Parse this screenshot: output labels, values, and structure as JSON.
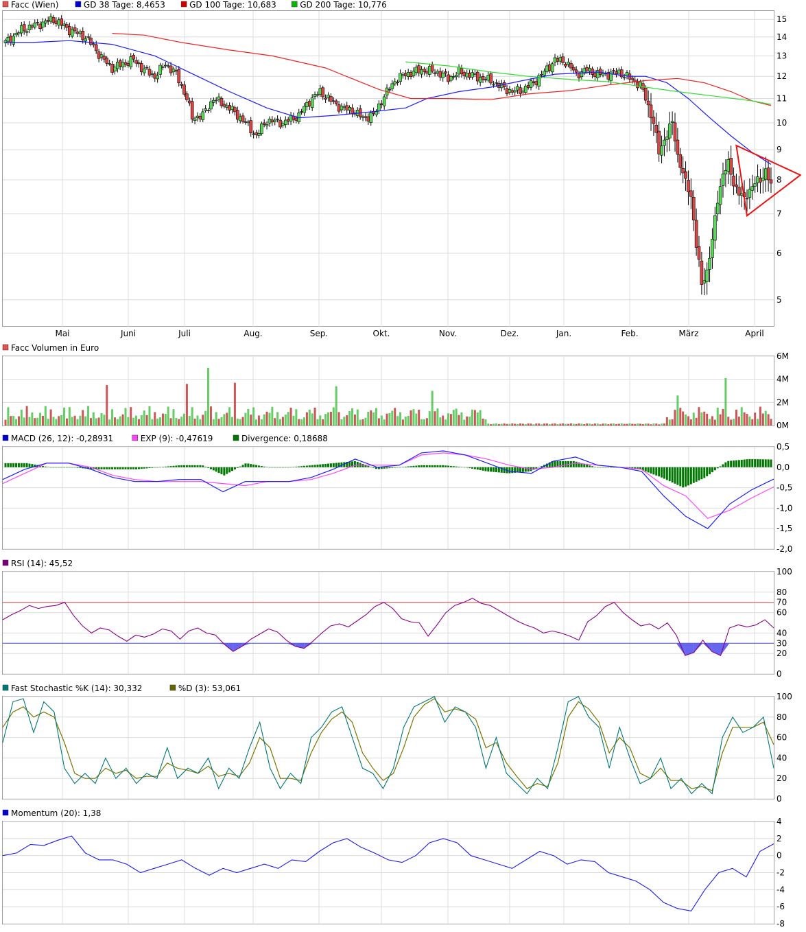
{
  "chart_data": [
    {
      "type": "candlestick",
      "panel": "price",
      "legend": [
        {
          "label": "Facc (Wien)",
          "color": "#e05050"
        },
        {
          "label": "GD 38 Tage: 8,4653",
          "color": "#0000cc"
        },
        {
          "label": "GD 100 Tage: 10,683",
          "color": "#cc0000"
        },
        {
          "label": "GD 200 Tage: 10,776",
          "color": "#00bb00"
        }
      ],
      "x_months": [
        "Mai",
        "Juni",
        "Juli",
        "Aug.",
        "Sep.",
        "Okt.",
        "Nov.",
        "Dez.",
        "Jan.",
        "Feb.",
        "März",
        "April"
      ],
      "y_ticks": [
        "15",
        "14",
        "13",
        "12",
        "11",
        "10",
        "9",
        "8",
        "7",
        "6",
        "5"
      ],
      "ylim": [
        4.5,
        15.5
      ],
      "y_scale": "log",
      "close_anchors": [
        [
          0,
          13.7
        ],
        [
          6,
          14.4
        ],
        [
          12,
          14.7
        ],
        [
          18,
          15.0
        ],
        [
          24,
          14.4
        ],
        [
          30,
          14.0
        ],
        [
          34,
          13.3
        ],
        [
          36,
          12.9
        ],
        [
          40,
          12.4
        ],
        [
          44,
          12.6
        ],
        [
          48,
          12.8
        ],
        [
          52,
          12.3
        ],
        [
          56,
          12.0
        ],
        [
          60,
          12.6
        ],
        [
          64,
          12.1
        ],
        [
          68,
          11.0
        ],
        [
          70,
          10.2
        ],
        [
          74,
          10.3
        ],
        [
          78,
          11.0
        ],
        [
          84,
          10.6
        ],
        [
          90,
          10.0
        ],
        [
          94,
          9.5
        ],
        [
          98,
          10.1
        ],
        [
          104,
          10.0
        ],
        [
          110,
          10.3
        ],
        [
          114,
          10.9
        ],
        [
          118,
          11.3
        ],
        [
          122,
          10.9
        ],
        [
          126,
          10.6
        ],
        [
          130,
          10.5
        ],
        [
          134,
          10.2
        ],
        [
          138,
          10.3
        ],
        [
          142,
          11.1
        ],
        [
          146,
          11.8
        ],
        [
          150,
          12.1
        ],
        [
          156,
          12.3
        ],
        [
          162,
          12.2
        ],
        [
          166,
          11.9
        ],
        [
          170,
          12.2
        ],
        [
          176,
          12.0
        ],
        [
          182,
          11.8
        ],
        [
          186,
          11.5
        ],
        [
          190,
          11.3
        ],
        [
          194,
          11.4
        ],
        [
          198,
          11.7
        ],
        [
          202,
          12.2
        ],
        [
          206,
          12.8
        ],
        [
          210,
          12.7
        ],
        [
          214,
          12.1
        ],
        [
          218,
          12.3
        ],
        [
          222,
          12.1
        ],
        [
          226,
          12.1
        ],
        [
          230,
          12.2
        ],
        [
          234,
          11.9
        ],
        [
          238,
          11.6
        ],
        [
          240,
          11.0
        ],
        [
          243,
          10.0
        ],
        [
          245,
          8.9
        ],
        [
          248,
          9.6
        ],
        [
          250,
          10.0
        ],
        [
          252,
          8.8
        ],
        [
          255,
          7.9
        ],
        [
          257,
          7.5
        ],
        [
          259,
          6.2
        ],
        [
          261,
          5.3
        ],
        [
          263,
          5.6
        ],
        [
          265,
          6.3
        ],
        [
          267,
          7.4
        ],
        [
          269,
          8.2
        ],
        [
          271,
          8.5
        ],
        [
          273,
          7.9
        ],
        [
          275,
          7.6
        ],
        [
          277,
          7.4
        ],
        [
          279,
          7.7
        ],
        [
          281,
          7.9
        ],
        [
          283,
          8.0
        ],
        [
          285,
          8.3
        ],
        [
          287,
          7.8
        ]
      ],
      "ma_lines": [
        {
          "name": "GD 38 Tage",
          "color": "#1a1aff",
          "points": [
            [
              0,
              13.7
            ],
            [
              10,
              13.7
            ],
            [
              24,
              13.8
            ],
            [
              40,
              13.6
            ],
            [
              56,
              13.0
            ],
            [
              72,
              12.0
            ],
            [
              84,
              11.3
            ],
            [
              98,
              10.6
            ],
            [
              110,
              10.2
            ],
            [
              124,
              10.3
            ],
            [
              138,
              10.45
            ],
            [
              150,
              10.6
            ],
            [
              158,
              11.0
            ],
            [
              170,
              11.3
            ],
            [
              182,
              11.5
            ],
            [
              194,
              11.8
            ],
            [
              206,
              12.1
            ],
            [
              222,
              12.2
            ],
            [
              234,
              12.0
            ],
            [
              240,
              12.0
            ],
            [
              248,
              11.7
            ],
            [
              256,
              11.0
            ],
            [
              264,
              10.2
            ],
            [
              272,
              9.5
            ],
            [
              280,
              8.9
            ],
            [
              287,
              8.5
            ]
          ]
        },
        {
          "name": "GD 100 Tage",
          "color": "#ee2222",
          "points": [
            [
              40,
              14.2
            ],
            [
              52,
              14.1
            ],
            [
              66,
              13.7
            ],
            [
              84,
              13.3
            ],
            [
              100,
              13.0
            ],
            [
              120,
              12.4
            ],
            [
              140,
              11.4
            ],
            [
              152,
              11.0
            ],
            [
              166,
              11.0
            ],
            [
              182,
              10.95
            ],
            [
              196,
              11.2
            ],
            [
              212,
              11.35
            ],
            [
              226,
              11.6
            ],
            [
              240,
              11.8
            ],
            [
              252,
              11.9
            ],
            [
              262,
              11.7
            ],
            [
              272,
              11.3
            ],
            [
              280,
              10.9
            ],
            [
              287,
              10.7
            ]
          ]
        },
        {
          "name": "GD 200 Tage",
          "color": "#33dd33",
          "points": [
            [
              150,
              12.7
            ],
            [
              166,
              12.5
            ],
            [
              182,
              12.2
            ],
            [
              196,
              12.0
            ],
            [
              212,
              11.85
            ],
            [
              226,
              11.75
            ],
            [
              240,
              11.5
            ],
            [
              252,
              11.3
            ],
            [
              266,
              11.1
            ],
            [
              280,
              10.9
            ],
            [
              287,
              10.75
            ]
          ]
        }
      ],
      "annotations": [
        {
          "type": "triangle",
          "color": "#ee1111",
          "points": [
            [
              274,
              9.15
            ],
            [
              298,
              8.15
            ],
            [
              278,
              6.95
            ]
          ]
        }
      ]
    },
    {
      "type": "bar",
      "panel": "volume",
      "legend": [
        {
          "label": "Facc Volumen in Euro",
          "color": "#e05050"
        }
      ],
      "y_ticks": [
        "6M",
        "4M",
        "2M",
        "0M"
      ],
      "ylim": [
        0,
        6
      ],
      "notable_values": [
        [
          38,
          3.5
        ],
        [
          68,
          3.6
        ],
        [
          76,
          5.0
        ],
        [
          86,
          3.7
        ],
        [
          124,
          3.4
        ],
        [
          160,
          3.0
        ],
        [
          270,
          4.1
        ],
        [
          252,
          2.6
        ]
      ]
    },
    {
      "type": "line",
      "panel": "macd",
      "legend": [
        {
          "label": "MACD (26, 12): -0,28931",
          "color": "#0000cc"
        },
        {
          "label": "EXP (9): -0,47619",
          "color": "#ff44ff"
        },
        {
          "label": "Divergence: 0,18688",
          "color": "#007700"
        }
      ],
      "y_ticks": [
        "0,5",
        "0,0",
        "-0,5",
        "-1,0",
        "-1,5",
        "-2,0"
      ],
      "ylim": [
        -2.0,
        0.5
      ],
      "series": [
        {
          "name": "MACD (26, 12)",
          "values": [
            -0.3,
            -0.05,
            0.1,
            0.1,
            -0.05,
            -0.25,
            -0.35,
            -0.35,
            -0.3,
            -0.3,
            -0.6,
            -0.35,
            -0.35,
            -0.35,
            -0.25,
            -0.05,
            0.2,
            0.0,
            0.05,
            0.35,
            0.4,
            0.3,
            0.1,
            -0.1,
            -0.15,
            0.15,
            0.25,
            0.05,
            0.0,
            -0.1,
            -0.7,
            -1.2,
            -1.5,
            -0.9,
            -0.55,
            -0.29
          ]
        },
        {
          "name": "EXP (9)",
          "values": [
            -0.4,
            -0.15,
            0.1,
            0.1,
            0.0,
            -0.2,
            -0.3,
            -0.35,
            -0.35,
            -0.35,
            -0.4,
            -0.45,
            -0.35,
            -0.35,
            -0.3,
            -0.15,
            0.05,
            0.05,
            0.05,
            0.3,
            0.35,
            0.3,
            0.2,
            0.05,
            -0.05,
            0.0,
            0.1,
            0.05,
            0.0,
            -0.05,
            -0.45,
            -0.7,
            -1.25,
            -1.05,
            -0.75,
            -0.48
          ]
        },
        {
          "name": "Divergence",
          "values": [
            0.1,
            0.1,
            0.0,
            0.0,
            -0.05,
            -0.05,
            -0.05,
            0.0,
            0.05,
            0.05,
            -0.2,
            0.1,
            0.0,
            0.0,
            0.05,
            0.1,
            0.15,
            -0.05,
            0.0,
            0.05,
            0.05,
            0.0,
            -0.1,
            -0.15,
            -0.1,
            0.15,
            0.15,
            0.0,
            0.0,
            -0.05,
            -0.25,
            -0.5,
            -0.25,
            0.15,
            0.2,
            0.19
          ]
        }
      ]
    },
    {
      "type": "line",
      "panel": "rsi",
      "legend": [
        {
          "label": "RSI (14): 45,52",
          "color": "#770077"
        }
      ],
      "y_ticks": [
        "100",
        "80",
        "60",
        "40",
        "20",
        "0"
      ],
      "ylim": [
        0,
        100
      ],
      "reference_lines": [
        {
          "value": 70,
          "label": "70",
          "color": "#dd4444"
        },
        {
          "value": 30,
          "label": "30",
          "color": "#4444dd"
        }
      ],
      "values": [
        53,
        58,
        62,
        67,
        64,
        66,
        67,
        70,
        57,
        47,
        40,
        45,
        43,
        37,
        32,
        38,
        36,
        39,
        44,
        42,
        34,
        42,
        45,
        40,
        38,
        29,
        22,
        27,
        34,
        39,
        44,
        41,
        33,
        27,
        25,
        32,
        40,
        47,
        49,
        46,
        52,
        58,
        66,
        70,
        64,
        54,
        51,
        50,
        37,
        48,
        60,
        67,
        70,
        74,
        69,
        67,
        62,
        57,
        52,
        48,
        45,
        40,
        42,
        40,
        37,
        33,
        51,
        57,
        66,
        70,
        60,
        53,
        47,
        49,
        44,
        50,
        38,
        18,
        21,
        33,
        22,
        18,
        45,
        48,
        46,
        48,
        53,
        45
      ]
    },
    {
      "type": "line",
      "panel": "stochastic",
      "legend": [
        {
          "label": "Fast Stochastic %K (14): 30,332",
          "color": "#007777"
        },
        {
          "label": "%D (3): 53,061",
          "color": "#666600"
        }
      ],
      "y_ticks": [
        "100",
        "80",
        "60",
        "40",
        "20",
        "0"
      ],
      "ylim": [
        0,
        100
      ],
      "series": [
        {
          "name": "Fast Stochastic %K (14)",
          "values": [
            55,
            95,
            98,
            65,
            95,
            85,
            30,
            15,
            25,
            15,
            40,
            20,
            30,
            15,
            25,
            20,
            50,
            20,
            30,
            25,
            40,
            10,
            30,
            20,
            50,
            75,
            30,
            10,
            25,
            15,
            60,
            70,
            85,
            90,
            60,
            30,
            25,
            10,
            30,
            70,
            90,
            95,
            100,
            75,
            90,
            85,
            70,
            30,
            60,
            25,
            15,
            5,
            20,
            10,
            50,
            95,
            100,
            80,
            70,
            30,
            70,
            40,
            15,
            20,
            40,
            10,
            20,
            5,
            15,
            5,
            60,
            80,
            65,
            70,
            80,
            30
          ]
        },
        {
          "name": "%D (3)",
          "values": [
            70,
            85,
            90,
            80,
            85,
            80,
            55,
            25,
            20,
            20,
            30,
            25,
            28,
            20,
            22,
            22,
            35,
            30,
            28,
            25,
            32,
            22,
            25,
            22,
            35,
            60,
            50,
            20,
            20,
            18,
            45,
            65,
            78,
            85,
            75,
            45,
            30,
            18,
            25,
            50,
            80,
            92,
            98,
            85,
            88,
            85,
            78,
            50,
            55,
            35,
            22,
            10,
            15,
            12,
            35,
            80,
            95,
            88,
            75,
            45,
            60,
            50,
            25,
            20,
            30,
            18,
            18,
            10,
            12,
            8,
            45,
            70,
            70,
            70,
            75,
            53
          ]
        }
      ]
    },
    {
      "type": "line",
      "panel": "momentum",
      "legend": [
        {
          "label": "Momentum (20): 1,38",
          "color": "#0000cc"
        }
      ],
      "y_ticks": [
        "4",
        "2",
        "0",
        "-2",
        "-4",
        "-6",
        "-8"
      ],
      "ylim": [
        -8,
        4
      ],
      "values": [
        0,
        0.3,
        1.3,
        1.2,
        1.8,
        2.3,
        0.3,
        -0.5,
        -0.5,
        -1.0,
        -2.0,
        -1.5,
        -1.0,
        -0.5,
        -1.5,
        -2.3,
        -1.5,
        -2.0,
        -1.5,
        -1.0,
        -1.5,
        -0.5,
        -0.7,
        0.5,
        1.5,
        2.0,
        1.0,
        0.3,
        -0.5,
        -0.8,
        0.0,
        1.5,
        2.0,
        1.5,
        0.0,
        -0.5,
        -1.0,
        -1.5,
        -0.5,
        0.5,
        0.0,
        -1.0,
        -0.5,
        -0.7,
        -2.0,
        -2.5,
        -3.0,
        -4.0,
        -5.5,
        -6.2,
        -6.5,
        -4.0,
        -2.0,
        -1.5,
        -2.5,
        0.5,
        1.38
      ]
    }
  ]
}
